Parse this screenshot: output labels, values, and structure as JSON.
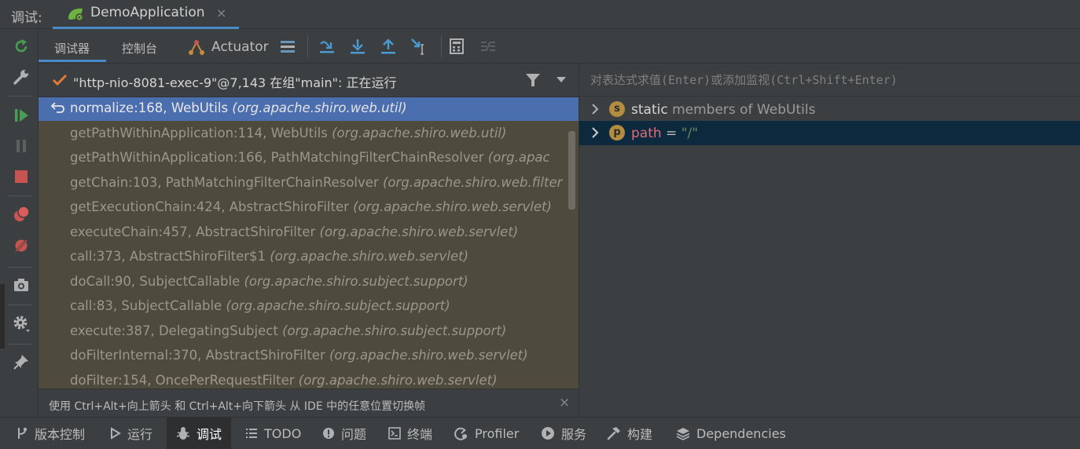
{
  "title_bar": {
    "debug_label": "调试:",
    "run_config_tab": "DemoApplication",
    "close_glyph": "×"
  },
  "toolbar": {
    "tab_debugger": "调试器",
    "tab_console": "控制台",
    "tab_actuator": "Actuator"
  },
  "frames": {
    "thread_label": "\"http-nio-8081-exec-9\"@7,143 在组\"main\": 正在运行",
    "items": [
      {
        "method": "normalize:168, WebUtils",
        "package": "(org.apache.shiro.web.util)"
      },
      {
        "method": "getPathWithinApplication:114, WebUtils",
        "package": "(org.apache.shiro.web.util)"
      },
      {
        "method": "getPathWithinApplication:166, PathMatchingFilterChainResolver",
        "package": "(org.apac"
      },
      {
        "method": "getChain:103, PathMatchingFilterChainResolver",
        "package": "(org.apache.shiro.web.filter"
      },
      {
        "method": "getExecutionChain:424, AbstractShiroFilter",
        "package": "(org.apache.shiro.web.servlet)"
      },
      {
        "method": "executeChain:457, AbstractShiroFilter",
        "package": "(org.apache.shiro.web.servlet)"
      },
      {
        "method": "call:373, AbstractShiroFilter$1",
        "package": "(org.apache.shiro.web.servlet)"
      },
      {
        "method": "doCall:90, SubjectCallable",
        "package": "(org.apache.shiro.subject.support)"
      },
      {
        "method": "call:83, SubjectCallable",
        "package": "(org.apache.shiro.subject.support)"
      },
      {
        "method": "execute:387, DelegatingSubject",
        "package": "(org.apache.shiro.subject.support)"
      },
      {
        "method": "doFilterInternal:370, AbstractShiroFilter",
        "package": "(org.apache.shiro.web.servlet)"
      },
      {
        "method": "doFilter:154, OncePerRequestFilter",
        "package": "(org.apache.shiro.web.servlet)"
      }
    ],
    "hint": "使用 Ctrl+Alt+向上箭头 和 Ctrl+Alt+向下箭头 从 IDE 中的任意位置切换帧"
  },
  "variables": {
    "eval_placeholder": "对表达式求值(Enter)或添加监视(Ctrl+Shift+Enter)",
    "static_badge": "s",
    "static_name": "static",
    "static_rest": " members of WebUtils",
    "path_badge": "p",
    "path_name": "path",
    "path_eq": " = ",
    "path_value": "\"/\""
  },
  "bottom_bar": {
    "version_control": "版本控制",
    "run": "运行",
    "debug": "调试",
    "todo": "TODO",
    "problems": "问题",
    "terminal": "终端",
    "profiler": "Profiler",
    "services": "服务",
    "build": "构建",
    "dependencies": "Dependencies"
  },
  "colors": {
    "accent": "#4a88c7",
    "selected_frame": "#4b6eaf",
    "frames_bg": "#4e4a3d",
    "variable_selected_bg": "#0d293e",
    "resume_green": "#499c54",
    "stop_red": "#c75450"
  }
}
